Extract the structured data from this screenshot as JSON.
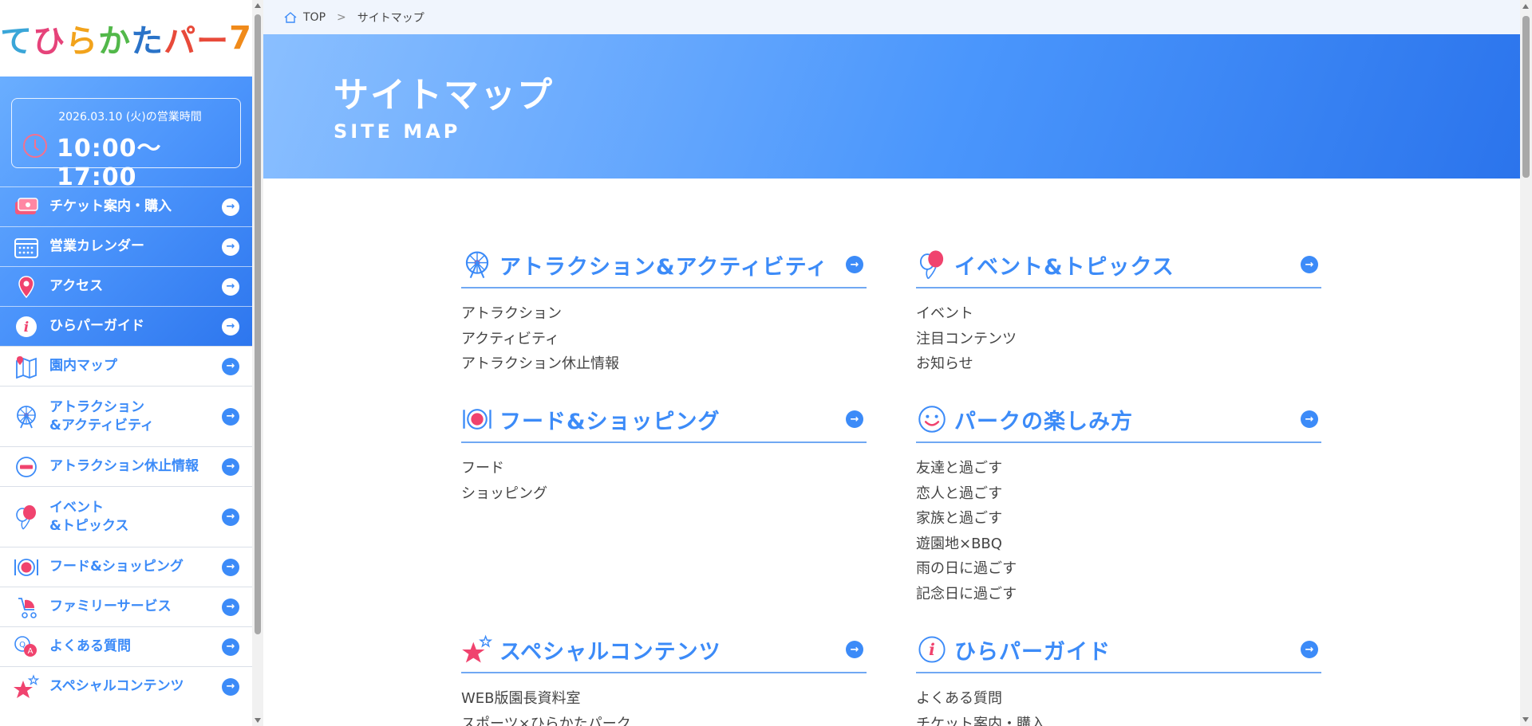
{
  "logo": {
    "parts": [
      "て",
      "ひ",
      "ら",
      "か",
      "た",
      "パー",
      "7"
    ]
  },
  "hours": {
    "date": "2026.03.10 (火)の営業時間",
    "time": "10:00〜17:00"
  },
  "sidebar": {
    "items": [
      {
        "label": "チケット案内・購入",
        "icon": "ticket-icon"
      },
      {
        "label": "営業カレンダー",
        "icon": "calendar-icon"
      },
      {
        "label": "アクセス",
        "icon": "map-pin-icon"
      },
      {
        "label": "ひらパーガイド",
        "icon": "info-icon"
      },
      {
        "label": "園内マップ",
        "icon": "park-map-icon"
      },
      {
        "label": "アトラクション\n&アクティビティ",
        "line1": "アトラクション",
        "line2": "&アクティビティ",
        "icon": "ferris-wheel-icon"
      },
      {
        "label": "アトラクション休止情報",
        "icon": "no-entry-icon"
      },
      {
        "label": "イベント\n&トピックス",
        "line1": "イベント",
        "line2": "&トピックス",
        "icon": "balloon-icon"
      },
      {
        "label": "フード&ショッピング",
        "icon": "plate-icon"
      },
      {
        "label": "ファミリーサービス",
        "icon": "stroller-icon"
      },
      {
        "label": "よくある質問",
        "icon": "qa-icon"
      },
      {
        "label": "スペシャルコンテンツ",
        "icon": "star-icon"
      }
    ]
  },
  "breadcrumb": {
    "home": "TOP",
    "current": "サイトマップ"
  },
  "hero": {
    "title": "サイトマップ",
    "subtitle": "SITE MAP"
  },
  "sections": [
    {
      "title": "アトラクション&アクティビティ",
      "icon": "ferris-wheel-icon",
      "links": [
        "アトラクション",
        "アクティビティ",
        "アトラクション休止情報"
      ]
    },
    {
      "title": "イベント&トピックス",
      "icon": "balloon-icon",
      "links": [
        "イベント",
        "注目コンテンツ",
        "お知らせ"
      ]
    },
    {
      "title": "フード&ショッピング",
      "icon": "plate-icon",
      "links": [
        "フード",
        "ショッピング"
      ]
    },
    {
      "title": "パークの楽しみ方",
      "icon": "smile-icon",
      "links": [
        "友達と過ごす",
        "恋人と過ごす",
        "家族と過ごす",
        "遊園地×BBQ",
        "雨の日に過ごす",
        "記念日に過ごす"
      ]
    },
    {
      "title": "スペシャルコンテンツ",
      "icon": "star-icon",
      "links": [
        "WEB版園長資料室",
        "スポーツ×ひらかたパーク"
      ]
    },
    {
      "title": "ひらパーガイド",
      "icon": "info-icon",
      "links": [
        "よくある質問",
        "チケット案内・購入"
      ]
    }
  ],
  "colors": {
    "accent": "#3c8bf8",
    "pink": "#e8436e",
    "heroStart": "#8abfff",
    "heroEnd": "#2b74ec"
  }
}
